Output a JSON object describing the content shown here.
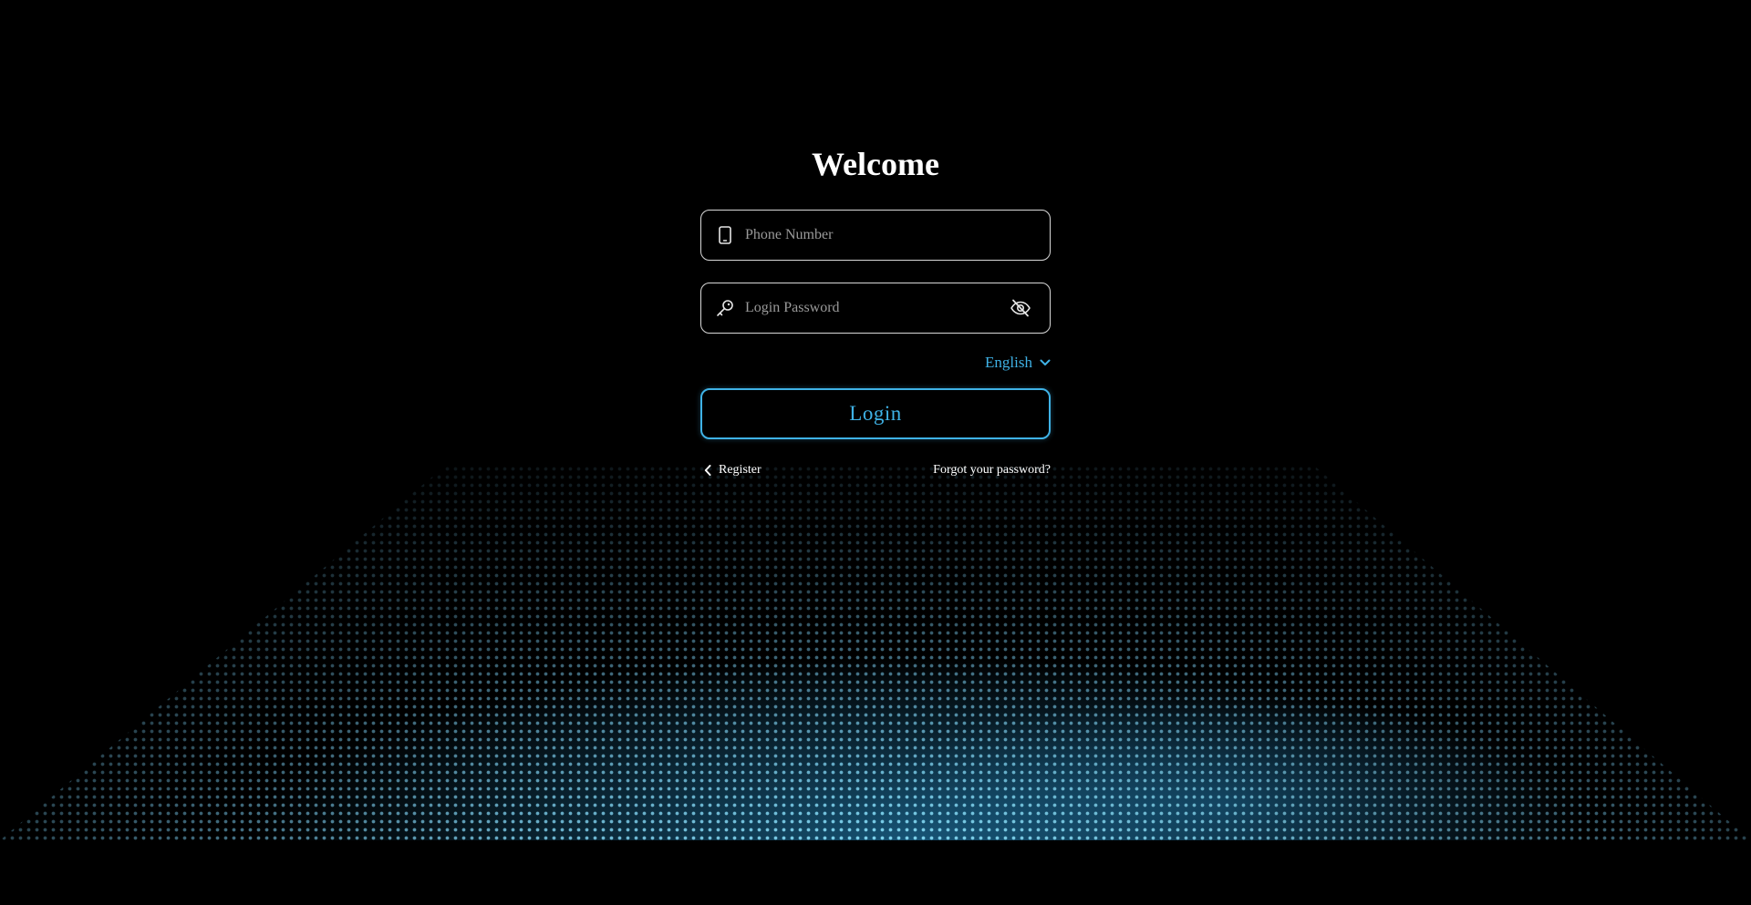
{
  "title": "Welcome",
  "phone": {
    "placeholder": "Phone Number",
    "value": "",
    "icon": "mobile-phone-icon"
  },
  "password": {
    "placeholder": "Login Password",
    "value": "",
    "icon": "key-icon",
    "toggle_icon": "eye-off-icon"
  },
  "language": {
    "selected": "English",
    "icon": "chevron-down-icon"
  },
  "login_label": "Login",
  "links": {
    "register": "Register",
    "register_icon": "chevron-left-icon",
    "forgot": "Forgot your password?"
  },
  "colors": {
    "background": "#000000",
    "accent": "#3fb2e6",
    "field_border": "#d8d8d8",
    "placeholder": "#9a9a9a",
    "text": "#ffffff"
  }
}
